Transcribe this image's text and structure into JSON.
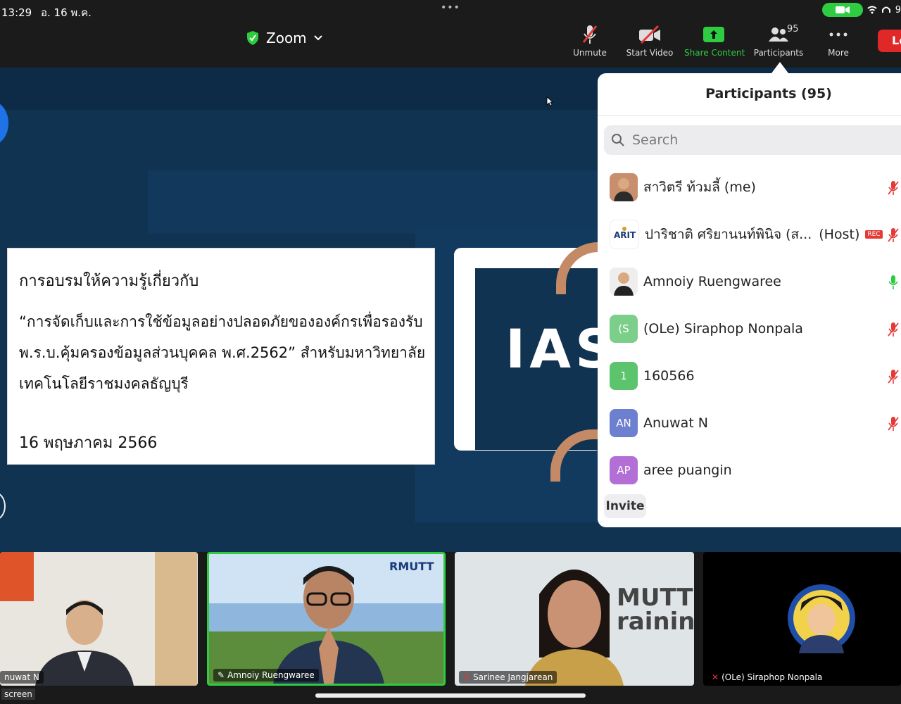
{
  "status_bar": {
    "time": "13:29",
    "date": "อ. 16 พ.ค.",
    "more_dots": "•••",
    "battery": "9"
  },
  "meeting": {
    "app_title": "Zoom"
  },
  "toolbar": {
    "unmute_label": "Unmute",
    "start_video_label": "Start Video",
    "share_content_label": "Share Content",
    "participants_label": "Participants",
    "participants_count": "95",
    "more_label": "More",
    "leave_label": "Le"
  },
  "slide": {
    "heading": "การอบรมให้ความรู้เกี่ยวกับ",
    "quote": "“การจัดเก็บและการใช้ข้อมูลอย่างปลอดภัยขององค์กรเพื่อรองรับ พ.ร.บ.คุ้มครองข้อมูลส่วนบุคคล พ.ศ.2562” สำหรับมหาวิทยาลัยเทคโนโลยีราชมงคลธัญบุรี",
    "date": "16 พฤษภาคม 2566",
    "logo_text": "IAS"
  },
  "participants_panel": {
    "title": "Participants (95)",
    "search_placeholder": "Search",
    "invite_label": "Invite",
    "participants": [
      {
        "initials": "",
        "name": "สาวิตรี ท้วมลี้ (me)",
        "role": "",
        "rec": "",
        "mic": "muted"
      },
      {
        "initials": "",
        "name": "ปาริชาติ ศริยานนท์พินิจ (ส...",
        "role": "(Host)",
        "rec": "REC",
        "mic": "muted"
      },
      {
        "initials": "",
        "name": "Amnoiy Ruengwaree",
        "role": "",
        "rec": "",
        "mic": "active"
      },
      {
        "initials": "(S",
        "name": "(OLe) Siraphop Nonpala",
        "role": "",
        "rec": "",
        "mic": "muted"
      },
      {
        "initials": "1",
        "name": "160566",
        "role": "",
        "rec": "",
        "mic": "muted"
      },
      {
        "initials": "AN",
        "name": "Anuwat N",
        "role": "",
        "rec": "",
        "mic": "muted"
      },
      {
        "initials": "AP",
        "name": "aree puangin",
        "role": "",
        "rec": "",
        "mic": "none"
      }
    ],
    "avatar_colors": [
      "#c98e6d",
      "#ffffff",
      "#eeeeee",
      "#7ccf8a",
      "#5cc46c",
      "#6d7fcf",
      "#b36fd6"
    ]
  },
  "video_strip": {
    "tiles": [
      {
        "name": "nuwat N"
      },
      {
        "name": "Amnoiy Ruengwaree"
      },
      {
        "name": "Sarinee Jangjarean"
      },
      {
        "name": "(OLe) Siraphop Nonpala"
      }
    ],
    "tile_backdrop_text": {
      "rmutt": "RMUTT",
      "training": "MUTT\nraining"
    },
    "screen_label": "screen"
  },
  "colors": {
    "accent_green": "#2ecc40",
    "leave_red": "#e02828",
    "content_bg": "#103352",
    "mute_red": "#e53935"
  }
}
